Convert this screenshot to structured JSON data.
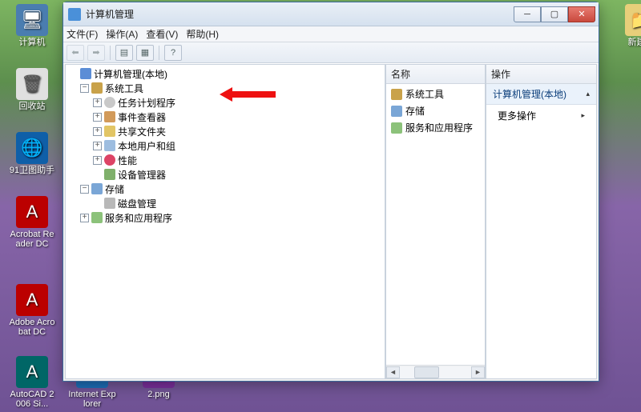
{
  "desktop": {
    "computer": "计算机",
    "recycle": "回收站",
    "weitu": "91卫图助手",
    "acroread": "Acrobat Reader DC",
    "adobe": "Adobe Acrobat DC",
    "autocad": "AutoCAD 2006 Si...",
    "ie": "Internet Explorer",
    "png2": "2.png",
    "xinjian": "新建文"
  },
  "window": {
    "title": "计算机管理",
    "menu": {
      "file": "文件(F)",
      "action": "操作(A)",
      "view": "查看(V)",
      "help": "帮助(H)"
    }
  },
  "tree": {
    "root": "计算机管理(本地)",
    "systools": "系统工具",
    "sched": "任务计划程序",
    "event": "事件查看器",
    "share": "共享文件夹",
    "users": "本地用户和组",
    "perf": "性能",
    "devmgr": "设备管理器",
    "storage": "存储",
    "disk": "磁盘管理",
    "services": "服务和应用程序"
  },
  "mid": {
    "header": "名称",
    "items": {
      "systools": "系统工具",
      "storage": "存储",
      "services": "服务和应用程序"
    }
  },
  "right": {
    "header": "操作",
    "group": "计算机管理(本地)",
    "more": "更多操作"
  },
  "glyph": {
    "expanded": "−",
    "collapsed": "+",
    "chev_right": "▸",
    "chev_up": "▴",
    "left": "◄",
    "right": "►"
  }
}
